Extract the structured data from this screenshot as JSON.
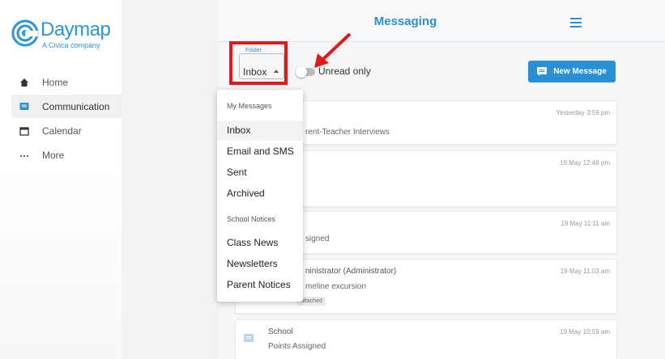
{
  "brand": {
    "name": "Daymap",
    "tagline": "A Civica company",
    "color": "#2a96d6"
  },
  "sidebar": {
    "items": [
      {
        "label": "Home",
        "icon": "home-icon",
        "active": false
      },
      {
        "label": "Communication",
        "icon": "message-icon",
        "active": true
      },
      {
        "label": "Calendar",
        "icon": "calendar-icon",
        "active": false
      },
      {
        "label": "More",
        "icon": "more-icon",
        "active": false
      }
    ]
  },
  "header": {
    "title": "Messaging",
    "menu_icon": "hamburger-menu-icon"
  },
  "toolbar": {
    "folder_legend": "Folder",
    "folder_value": "Inbox",
    "unread_label": "Unread only",
    "unread_enabled": false,
    "new_message_label": "New Message"
  },
  "dropdown": {
    "section1": "My Messages",
    "section2": "School Notices",
    "items": [
      {
        "label": "Inbox",
        "selected": true
      },
      {
        "label": "Email and SMS",
        "selected": false
      },
      {
        "label": "Sent",
        "selected": false
      },
      {
        "label": "Archived",
        "selected": false
      },
      {
        "label": "Class News",
        "selected": false
      },
      {
        "label": "Newsletters",
        "selected": false
      },
      {
        "label": "Parent Notices",
        "selected": false
      }
    ]
  },
  "messages": [
    {
      "time": "Yesterday 3:59 pm",
      "line1": "",
      "line2": "rent-Teacher Interviews"
    },
    {
      "time": "19 May 12:48 pm",
      "line1": "",
      "line2": ""
    },
    {
      "time": "19 May 11:11 am",
      "line1": "",
      "line2": "signed"
    },
    {
      "time": "19 May 11:03 am",
      "line1": "ninistrator (Administrator)",
      "line2": "meline excursion",
      "badge": "attached"
    },
    {
      "time": "19 May 10:59 am",
      "line1": "School",
      "line2": "Points Assigned"
    }
  ],
  "colors": {
    "accent": "#2e8fcf",
    "annotation": "#e01a1a",
    "button": "#2a8fd4"
  }
}
